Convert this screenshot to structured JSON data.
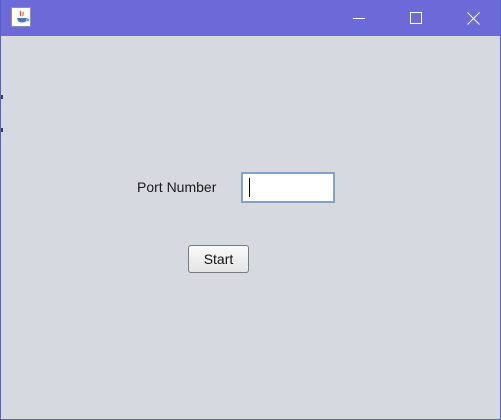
{
  "window": {
    "titlebar_color": "#6b6ad8",
    "background_color": "#d6d9e0",
    "app_icon": "java-app-icon",
    "controls": {
      "minimize_icon": "minimize-icon",
      "maximize_icon": "maximize-icon",
      "close_icon": "close-icon"
    }
  },
  "form": {
    "port_label": "Port Number",
    "port_value": "",
    "start_label": "Start"
  }
}
